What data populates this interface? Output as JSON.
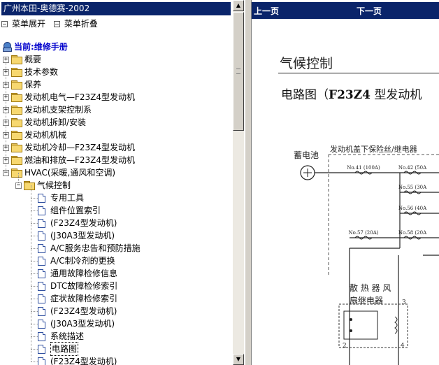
{
  "left_pane": {
    "title": "广州本田-奥德赛-2002",
    "toolbar": {
      "expand_label": "菜单展开",
      "collapse_label": "菜单折叠"
    },
    "current_label": "当前:维修手册",
    "tree_top": [
      {
        "label": "概要",
        "expanded": false
      },
      {
        "label": "技术参数",
        "expanded": false
      },
      {
        "label": "保养",
        "expanded": false
      },
      {
        "label": "发动机电气—F23Z4型发动机",
        "expanded": false
      },
      {
        "label": "发动机支架控制系",
        "expanded": false
      },
      {
        "label": "发动机拆卸/安装",
        "expanded": false
      },
      {
        "label": "发动机机械",
        "expanded": false
      },
      {
        "label": "发动机冷却—F23Z4型发动机",
        "expanded": false
      },
      {
        "label": "燃油和排放—F23Z4型发动机",
        "expanded": false
      },
      {
        "label": "HVAC(采暖,通风和空调)",
        "expanded": true
      }
    ],
    "subfolder": {
      "label": "气候控制",
      "expanded": true
    },
    "leaf_items": [
      {
        "label": "专用工具",
        "selected": false
      },
      {
        "label": "组件位置索引",
        "selected": false
      },
      {
        "label": "(F23Z4型发动机)",
        "selected": false
      },
      {
        "label": "(J30A3型发动机)",
        "selected": false
      },
      {
        "label": "A/C服务忠告和预防措施",
        "selected": false
      },
      {
        "label": "A/C制冷剂的更换",
        "selected": false
      },
      {
        "label": "通用故障检修信息",
        "selected": false
      },
      {
        "label": "DTC故障检修索引",
        "selected": false
      },
      {
        "label": "症状故障检修索引",
        "selected": false
      },
      {
        "label": "(F23Z4型发动机)",
        "selected": false
      },
      {
        "label": "(J30A3型发动机)",
        "selected": false
      },
      {
        "label": "系统描述",
        "selected": false
      },
      {
        "label": "电路图",
        "selected": true
      },
      {
        "label": "(F23Z4型发动机)",
        "selected": false
      }
    ]
  },
  "right_pane": {
    "nav": {
      "prev_label": "上一页",
      "next_label": "下一页"
    },
    "doc_title": "气候控制",
    "doc_subtitle_prefix": "电路图（",
    "doc_subtitle_bold": "F23Z4",
    "doc_subtitle_suffix": " 型发动机",
    "diagram": {
      "battery_label": "蓄电池",
      "fusebox_label": "发动机盖下保险丝/继电器",
      "fuses": [
        "No.41 (100A)",
        "No.42 (50A",
        "No.55 (30A",
        "No.56 (40A",
        "No.57 (20A)",
        "No.58 (20A"
      ],
      "relay_label_1": "散 热 器 风",
      "relay_label_2": "扇继电器",
      "pins": [
        "3",
        "2",
        "4"
      ]
    }
  }
}
